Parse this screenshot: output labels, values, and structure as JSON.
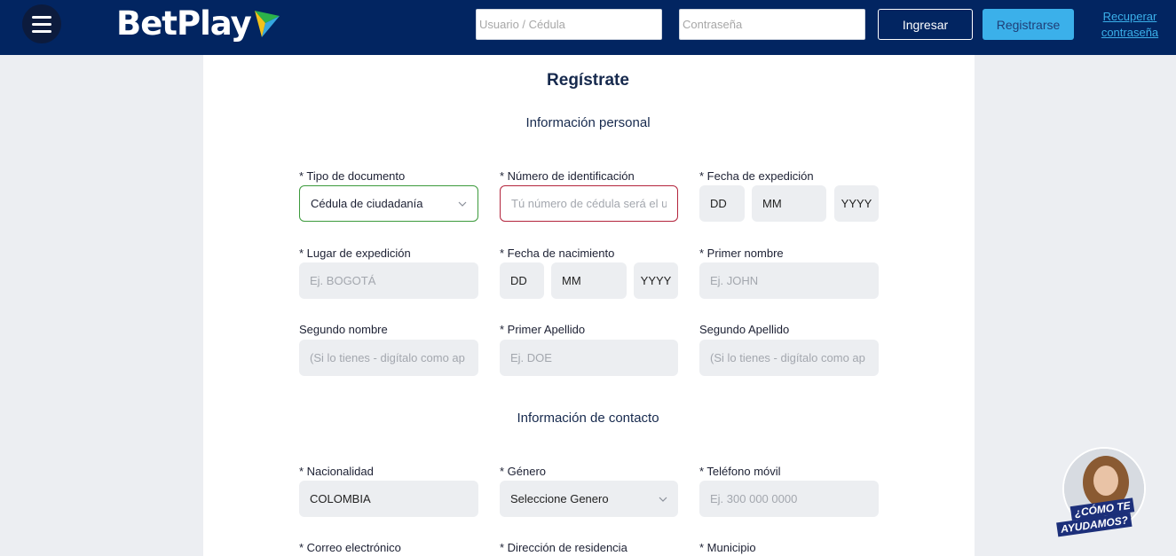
{
  "header": {
    "brand": "BetPlay",
    "user_placeholder": "Usuario / Cédula",
    "password_placeholder": "Contraseña",
    "login_label": "Ingresar",
    "register_label": "Registrarse",
    "recover_line1": "Recuperar",
    "recover_line2": "contraseña"
  },
  "form": {
    "title": "Regístrate",
    "personal_section": "Información personal",
    "contact_section": "Información de contacto",
    "fields": {
      "doc_type": {
        "label": "* Tipo de documento",
        "value": "Cédula de ciudadanía"
      },
      "id_number": {
        "label": "* Número de identificación",
        "placeholder": "Tú número de cédula será el u"
      },
      "issue_date": {
        "label": "* Fecha de expedición",
        "dd": "DD",
        "mm": "MM",
        "yyyy": "YYYY"
      },
      "issue_place": {
        "label": "* Lugar de expedición",
        "placeholder": "Ej. BOGOTÁ"
      },
      "birth_date": {
        "label": "* Fecha de nacimiento",
        "dd": "DD",
        "mm": "MM",
        "yyyy": "YYYY"
      },
      "first_name": {
        "label": "* Primer nombre",
        "placeholder": "Ej. JOHN"
      },
      "second_name": {
        "label": "Segundo nombre",
        "placeholder": "(Si lo tienes - digítalo como ap"
      },
      "first_surname": {
        "label": "* Primer Apellido",
        "placeholder": "Ej. DOE"
      },
      "second_surname": {
        "label": "Segundo Apellido",
        "placeholder": "(Si lo tienes - digítalo como ap"
      },
      "nationality": {
        "label": "* Nacionalidad",
        "value": "COLOMBIA"
      },
      "gender": {
        "label": "* Género",
        "value": "Seleccione Genero"
      },
      "mobile": {
        "label": "* Teléfono móvil",
        "placeholder": "Ej. 300 000 0000"
      },
      "email": {
        "label": "* Correo electrónico"
      },
      "address": {
        "label": "* Dirección de residencia"
      },
      "municipality": {
        "label": "* Municipio"
      }
    }
  },
  "help_widget": {
    "line1": "¿CÓMO TE",
    "line2": "AYUDAMOS?"
  }
}
